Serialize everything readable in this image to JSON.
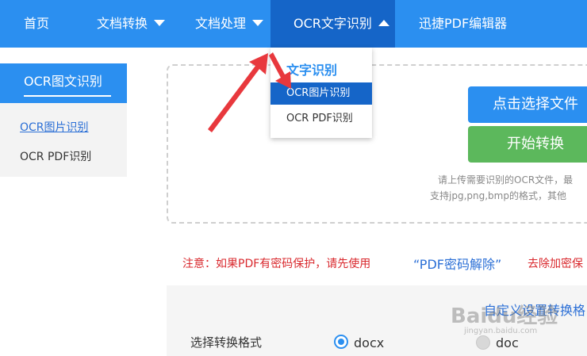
{
  "nav": {
    "home": "首页",
    "doc_convert": "文档转换",
    "doc_process": "文档处理",
    "ocr": "OCR文字识别",
    "pdf_editor": "迅捷PDF编辑器"
  },
  "dropdown": {
    "title": "文字识别",
    "items": [
      "OCR图片识别",
      "OCR PDF识别"
    ]
  },
  "sidebar": {
    "header": "OCR图文识别",
    "items": [
      "OCR图片识别",
      "OCR PDF识别"
    ]
  },
  "upload": {
    "select_button": "点击选择文件",
    "start_button": "开始转换",
    "hint_line1": "请上传需要识别的OCR文件，最",
    "hint_line2": "支持jpg,png,bmp的格式，其他"
  },
  "notice": {
    "prefix": "注意：如果PDF有密码保护，请先使用",
    "link": "“PDF密码解除”",
    "suffix": "去除加密保"
  },
  "settings": {
    "title": "自定义设置转换格",
    "format_label": "选择转换格式",
    "options": [
      {
        "label": "docx",
        "selected": true
      },
      {
        "label": "doc",
        "selected": false
      }
    ]
  },
  "watermark": {
    "text": "Baidu经验",
    "sub": "jingyan.baidu.com"
  },
  "colors": {
    "primary": "#2b8ff0",
    "primary_dark": "#1565c8",
    "green": "#5cb85c",
    "alert_red": "#d9282d",
    "arrow_red": "#e8383d"
  }
}
